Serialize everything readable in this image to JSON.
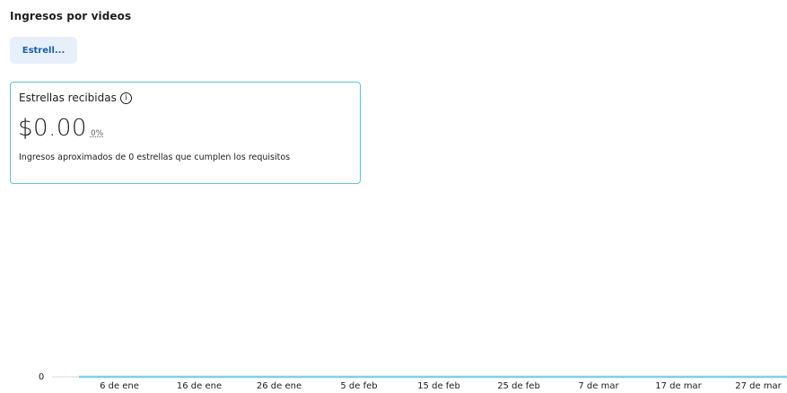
{
  "header": {
    "title": "Ingresos por videos"
  },
  "filter": {
    "label": "Estrell..."
  },
  "metric_card": {
    "label": "Estrellas recibidas",
    "info_glyph": "i",
    "value": "$0.00",
    "delta": "0%",
    "description": "Ingresos aproximados de 0 estrellas que cumplen los requisitos"
  },
  "colors": {
    "accent": "#5fc3d1",
    "line": "#7fd0e8",
    "chip_bg": "#e7f0fa",
    "chip_text": "#1a5fa8"
  },
  "chart_data": {
    "type": "line",
    "title": "",
    "xlabel": "",
    "ylabel": "",
    "x_tick_labels": [
      "6 de ene",
      "16 de ene",
      "26 de ene",
      "5 de feb",
      "15 de feb",
      "25 de feb",
      "7 de mar",
      "17 de mar",
      "27 de mar"
    ],
    "y_tick_labels": [
      "0"
    ],
    "ylim": [
      0,
      0
    ],
    "series": [
      {
        "values": [
          0,
          0,
          0,
          0,
          0,
          0,
          0,
          0,
          0
        ]
      }
    ]
  }
}
